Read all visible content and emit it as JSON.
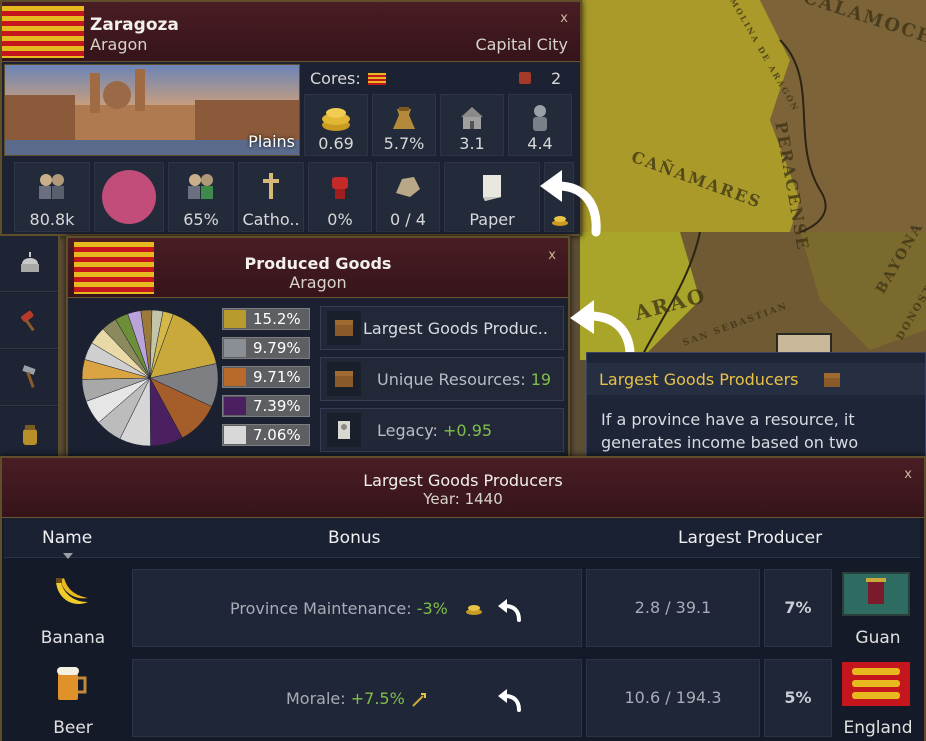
{
  "map": {
    "labels": [
      "CALAMOCHA",
      "PERACENSE",
      "CAÑAMARES",
      "MOLINA DE ARAGÓN",
      "BAYONA",
      "DONOSTIA",
      "SAN SEBASTIAN",
      "ARAO"
    ]
  },
  "province": {
    "name": "Zaragoza",
    "owner": "Aragon",
    "status": "Capital City",
    "terrain": "Plains",
    "close_label": "x",
    "cores_label": "Cores:",
    "core_count": "2",
    "stats": [
      {
        "icon": "coins-icon",
        "value": "0.69"
      },
      {
        "icon": "goods-sack-icon",
        "value": "5.7%"
      },
      {
        "icon": "building-icon",
        "value": "3.1"
      },
      {
        "icon": "soldier-icon",
        "value": "4.4"
      }
    ],
    "bottom_stats": [
      {
        "icon": "population-icon",
        "value": "80.8k",
        "color": "#7fbf4a"
      },
      {
        "icon": "culture-circle-icon",
        "value": ""
      },
      {
        "icon": "people-icon",
        "value": "65%"
      },
      {
        "icon": "cross-icon",
        "value": "Catho.."
      },
      {
        "icon": "fist-icon",
        "value": "0%"
      },
      {
        "icon": "ore-icon",
        "value": "0 / 4"
      },
      {
        "icon": "paper-scroll-icon",
        "value": "Paper"
      }
    ]
  },
  "produced_goods": {
    "title": "Produced Goods",
    "subtitle": "Aragon",
    "close_label": "x",
    "shares": [
      {
        "icon": "grain-icon",
        "value": "15.2%",
        "color": "#b89a2e"
      },
      {
        "icon": "fish-icon",
        "value": "9.79%",
        "color": "#8a8f96"
      },
      {
        "icon": "cattle-icon",
        "value": "9.71%",
        "color": "#b86a2a"
      },
      {
        "icon": "wine-icon",
        "value": "7.39%",
        "color": "#4a2060"
      },
      {
        "icon": "salt-icon",
        "value": "7.06%",
        "color": "#d8d8d8"
      }
    ],
    "buttons": [
      {
        "icon": "chest-icon",
        "label": "Largest Goods Produc..",
        "value": ""
      },
      {
        "icon": "chest-icon",
        "label": "Unique Resources: ",
        "value": "19"
      },
      {
        "icon": "scroll-icon",
        "label": "Legacy: ",
        "value": "+0.95"
      }
    ],
    "chart_data": {
      "type": "pie",
      "title": "",
      "slices": [
        {
          "label": "",
          "value": 15.2,
          "color": "#c9a93b"
        },
        {
          "label": "",
          "value": 9.79,
          "color": "#7d7f83"
        },
        {
          "label": "",
          "value": 9.71,
          "color": "#a55d2a"
        },
        {
          "label": "",
          "value": 7.39,
          "color": "#4a2060"
        },
        {
          "label": "",
          "value": 7.06,
          "color": "#d6d6d6"
        },
        {
          "label": "",
          "value": 6.0,
          "color": "#bcbcbc"
        },
        {
          "label": "",
          "value": 5.5,
          "color": "#e6e6e6"
        },
        {
          "label": "",
          "value": 5.0,
          "color": "#a8a8a8"
        },
        {
          "label": "",
          "value": 4.5,
          "color": "#d9a441"
        },
        {
          "label": "",
          "value": 4.0,
          "color": "#cfcfcf"
        },
        {
          "label": "",
          "value": 4.0,
          "color": "#e9d9a6"
        },
        {
          "label": "",
          "value": 3.5,
          "color": "#8a8a5c"
        },
        {
          "label": "",
          "value": 3.0,
          "color": "#6e8f3a"
        },
        {
          "label": "",
          "value": 3.0,
          "color": "#b9a3d9"
        },
        {
          "label": "",
          "value": 2.5,
          "color": "#9c7a3c"
        },
        {
          "label": "",
          "value": 2.5,
          "color": "#c4c4a8"
        },
        {
          "label": "",
          "value": 2.35,
          "color": "#d4b84a"
        }
      ]
    }
  },
  "sidebar": {
    "items": [
      {
        "icon": "capitol-dome-icon"
      },
      {
        "icon": "gavel-icon"
      },
      {
        "icon": "hammer-icon"
      },
      {
        "icon": "goods-jar-icon"
      }
    ]
  },
  "tooltip": {
    "title": "Largest Goods Producers",
    "body_line1": "If a province have a resource, it",
    "body_line2": "generates income based on two"
  },
  "largest": {
    "title": "Largest Goods Producers",
    "year_label": "Year: 1440",
    "close_label": "x",
    "columns": {
      "name": "Name",
      "bonus": "Bonus",
      "producer": "Largest Producer"
    },
    "rows": [
      {
        "good": "Banana",
        "good_icon": "banana-icon",
        "bonus_label": "Province Maintenance: ",
        "bonus_value": "-3%",
        "bonus_icon": "coins-icon",
        "amount": "2.8 / 39.1",
        "share": "7%",
        "producer": "Guan",
        "producer_flag": "guan-flag-icon"
      },
      {
        "good": "Beer",
        "good_icon": "beer-icon",
        "bonus_label": "Morale: ",
        "bonus_value": "+7.5%",
        "bonus_icon": "sword-icon",
        "amount": "10.6 / 194.3",
        "share": "5%",
        "producer": "England",
        "producer_flag": "england-flag-icon"
      }
    ]
  },
  "colors": {
    "green_value": "#7fbf4a",
    "yellow_title": "#e8c246",
    "header_red": "#4a1d24"
  }
}
